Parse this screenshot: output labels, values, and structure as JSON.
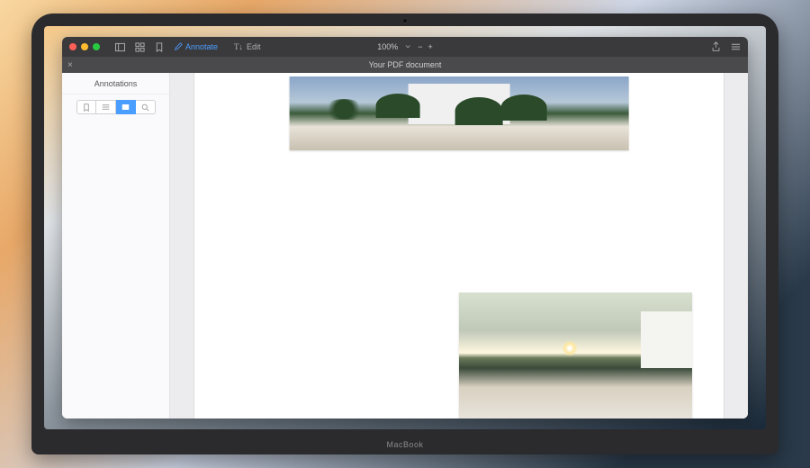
{
  "toolbar": {
    "annotate_label": "Annotate",
    "edit_label": "Edit",
    "zoom_level": "100%"
  },
  "document_title": "Your PDF document",
  "sidebar": {
    "title": "Annotations"
  }
}
